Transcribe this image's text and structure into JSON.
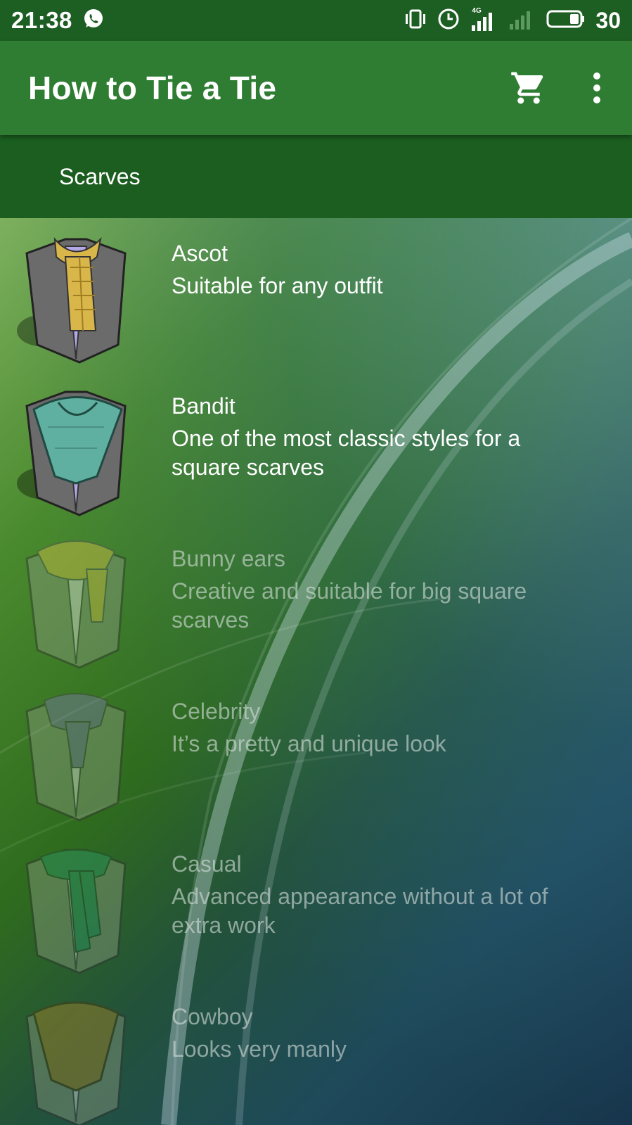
{
  "status_bar": {
    "time": "21:38",
    "network": "4G",
    "battery": "30",
    "icons": [
      "whatsapp-icon",
      "vibrate-icon",
      "alarm-icon",
      "signal-4g-icon",
      "signal-weak-icon",
      "battery-icon"
    ]
  },
  "app_bar": {
    "title": "How to Tie a Tie",
    "actions": [
      "cart-icon",
      "more-vert-icon"
    ]
  },
  "tabs": [
    {
      "label": "Scarves",
      "selected": true
    }
  ],
  "items": [
    {
      "name": "Ascot",
      "description": "Suitable for any outfit",
      "scarf_color": "#d9b64a",
      "dimmed": false
    },
    {
      "name": "Bandit",
      "description": "One of the most classic styles for a square scarves",
      "scarf_color": "#5fb0a0",
      "dimmed": false
    },
    {
      "name": "Bunny ears",
      "description": "Creative and suitable for big square scarves",
      "scarf_color": "#d8c24a",
      "dimmed": true
    },
    {
      "name": "Celebrity",
      "description": "It’s a pretty and unique look",
      "scarf_color": "#7a7aa8",
      "dimmed": true
    },
    {
      "name": "Casual",
      "description": "Advanced appearance without a lot of extra work",
      "scarf_color": "#2f9a6a",
      "dimmed": true
    },
    {
      "name": "Cowboy",
      "description": "Looks very manly",
      "scarf_color": "#a8862c",
      "dimmed": true
    }
  ],
  "colors": {
    "status_bar": "#1d5e22",
    "app_bar": "#2e7d32",
    "tab_bar": "#1b5e20"
  }
}
